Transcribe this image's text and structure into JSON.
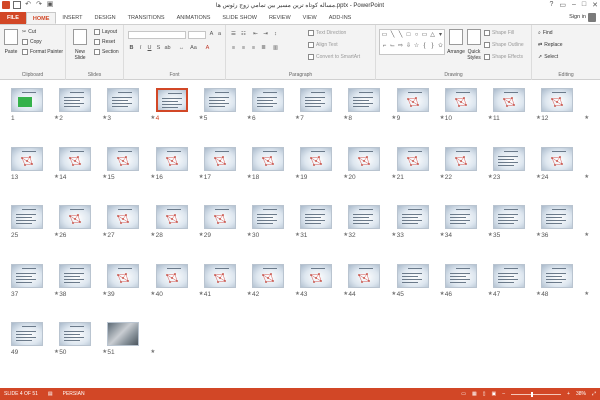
{
  "window": {
    "title": "ﻣﺴﺎﻟﻪ ﮐﻮﺗﺎﻩ ﺗﺮﻳﻦ ﻣﺴﻴﺮ ﺑﻴﻦ ﺗﻤﺎﻣﻲ ﺯﻭﺝ ﺭﺋﻮﺱ ﻫﺎ.pptx - PowerPoint"
  },
  "tabs": [
    "FILE",
    "HOME",
    "INSERT",
    "DESIGN",
    "TRANSITIONS",
    "ANIMATIONS",
    "SLIDE SHOW",
    "REVIEW",
    "VIEW",
    "ADD-INS"
  ],
  "account": {
    "sign_in": "Sign in"
  },
  "ribbon": {
    "clipboard": {
      "paste": "Paste",
      "cut": "Cut",
      "copy": "Copy",
      "format_painter": "Format Painter",
      "label": "Clipboard"
    },
    "slides": {
      "new_slide": "New Slide",
      "layout": "Layout",
      "reset": "Reset",
      "section": "Section",
      "label": "Slides"
    },
    "font": {
      "label": "Font"
    },
    "paragraph": {
      "text_direction": "Text Direction",
      "align_text": "Align Text",
      "convert_smartart": "Convert to SmartArt",
      "label": "Paragraph"
    },
    "drawing": {
      "arrange": "Arrange",
      "quick_styles": "Quick Styles",
      "shape_fill": "Shape Fill",
      "shape_outline": "Shape Outline",
      "shape_effects": "Shape Effects",
      "label": "Drawing"
    },
    "editing": {
      "find": "Find",
      "replace": "Replace",
      "select": "Select",
      "label": "Editing"
    }
  },
  "slides": [
    {
      "n": "1",
      "kind": "green"
    },
    {
      "n": "2",
      "kind": "text"
    },
    {
      "n": "3",
      "kind": "text"
    },
    {
      "n": "4",
      "kind": "text"
    },
    {
      "n": "5",
      "kind": "text"
    },
    {
      "n": "6",
      "kind": "text"
    },
    {
      "n": "7",
      "kind": "text"
    },
    {
      "n": "8",
      "kind": "text"
    },
    {
      "n": "9",
      "kind": "diagram"
    },
    {
      "n": "10",
      "kind": "diagram"
    },
    {
      "n": "11",
      "kind": "diagram"
    },
    {
      "n": "12",
      "kind": "diagram"
    },
    {
      "n": "13",
      "kind": "diagram"
    },
    {
      "n": "14",
      "kind": "diagram"
    },
    {
      "n": "15",
      "kind": "diagram"
    },
    {
      "n": "16",
      "kind": "diagram"
    },
    {
      "n": "17",
      "kind": "diagram"
    },
    {
      "n": "18",
      "kind": "diagram"
    },
    {
      "n": "19",
      "kind": "diagram"
    },
    {
      "n": "20",
      "kind": "diagram"
    },
    {
      "n": "21",
      "kind": "diagram"
    },
    {
      "n": "22",
      "kind": "diagram"
    },
    {
      "n": "23",
      "kind": "text"
    },
    {
      "n": "24",
      "kind": "diagram"
    },
    {
      "n": "25",
      "kind": "text"
    },
    {
      "n": "26",
      "kind": "diagram"
    },
    {
      "n": "27",
      "kind": "diagram"
    },
    {
      "n": "28",
      "kind": "diagram"
    },
    {
      "n": "29",
      "kind": "diagram"
    },
    {
      "n": "30",
      "kind": "text"
    },
    {
      "n": "31",
      "kind": "text"
    },
    {
      "n": "32",
      "kind": "text"
    },
    {
      "n": "33",
      "kind": "text"
    },
    {
      "n": "34",
      "kind": "text"
    },
    {
      "n": "35",
      "kind": "text"
    },
    {
      "n": "36",
      "kind": "text"
    },
    {
      "n": "37",
      "kind": "text"
    },
    {
      "n": "38",
      "kind": "text"
    },
    {
      "n": "39",
      "kind": "diagram"
    },
    {
      "n": "40",
      "kind": "diagram"
    },
    {
      "n": "41",
      "kind": "diagram"
    },
    {
      "n": "42",
      "kind": "diagram"
    },
    {
      "n": "43",
      "kind": "diagram"
    },
    {
      "n": "44",
      "kind": "diagram"
    },
    {
      "n": "45",
      "kind": "text"
    },
    {
      "n": "46",
      "kind": "text"
    },
    {
      "n": "47",
      "kind": "text"
    },
    {
      "n": "48",
      "kind": "text"
    },
    {
      "n": "49",
      "kind": "text"
    },
    {
      "n": "50",
      "kind": "text"
    },
    {
      "n": "51",
      "kind": "photo"
    }
  ],
  "selected_slide": "4",
  "statusbar": {
    "slide_info": "SLIDE 4 OF 51",
    "language": "PERSIAN",
    "zoom": "38%"
  },
  "colors": {
    "accent": "#d24726",
    "ribbon_bg": "#f3f3f3"
  }
}
